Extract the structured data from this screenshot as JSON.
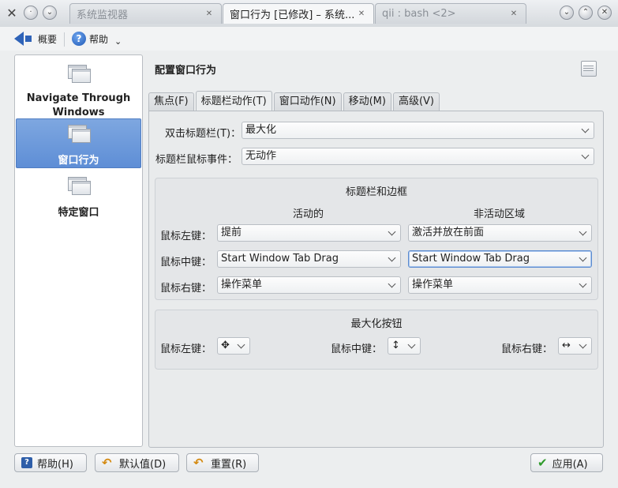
{
  "titlebar": {
    "tabs": [
      {
        "label": "系统监视器"
      },
      {
        "label": "窗口行为 [已修改] – 系统..."
      },
      {
        "label": "qii : bash <2>"
      }
    ]
  },
  "toolbar": {
    "overview_label": "概要",
    "help_label": "帮助"
  },
  "sidebar": {
    "items": [
      {
        "label": "Navigate Through Windows"
      },
      {
        "label": "窗口行为"
      },
      {
        "label": "特定窗口"
      }
    ]
  },
  "content": {
    "title": "配置窗口行为",
    "tabs": [
      {
        "label": "焦点(F)"
      },
      {
        "label": "标题栏动作(T)"
      },
      {
        "label": "窗口动作(N)"
      },
      {
        "label": "移动(M)"
      },
      {
        "label": "高级(V)"
      }
    ],
    "double_click": {
      "label": "双击标题栏(T)：",
      "value": "最大化"
    },
    "wheel": {
      "label": "标题栏鼠标事件：",
      "value": "无动作"
    },
    "titlebar_frame": {
      "title": "标题栏和边框",
      "active_header": "活动的",
      "inactive_header": "非活动区域",
      "rows": [
        {
          "label": "鼠标左键：",
          "active": "提前",
          "inactive": "激活并放在前面"
        },
        {
          "label": "鼠标中键：",
          "active": "Start Window Tab Drag",
          "inactive": "Start Window Tab Drag"
        },
        {
          "label": "鼠标右键：",
          "active": "操作菜单",
          "inactive": "操作菜单"
        }
      ]
    },
    "maximize": {
      "title": "最大化按钮",
      "left_label": "鼠标左键：",
      "left_icon": "✥",
      "middle_label": "鼠标中键：",
      "middle_icon": "↕",
      "right_label": "鼠标右键：",
      "right_icon": "↔"
    }
  },
  "buttons": {
    "help": "帮助(H)",
    "defaults": "默认值(D)",
    "reset": "重置(R)",
    "apply": "应用(A)"
  }
}
